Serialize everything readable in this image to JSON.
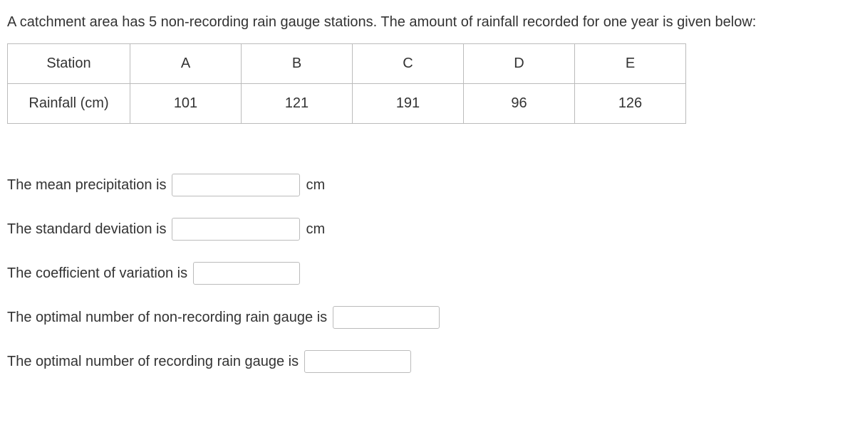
{
  "intro": "A catchment area has 5 non-recording rain gauge stations. The amount of rainfall recorded for one year is given below:",
  "table": {
    "row1": {
      "header": "Station",
      "cells": [
        "A",
        "B",
        "C",
        "D",
        "E"
      ]
    },
    "row2": {
      "header": "Rainfall (cm)",
      "cells": [
        "101",
        "121",
        "191",
        "96",
        "126"
      ]
    }
  },
  "questions": {
    "q1": {
      "label": "The mean precipitation is",
      "unit": "cm"
    },
    "q2": {
      "label": "The standard deviation is",
      "unit": "cm"
    },
    "q3": {
      "label": "The coefficient of variation is"
    },
    "q4": {
      "label": "The optimal number of non-recording  rain gauge is"
    },
    "q5": {
      "label": "The optimal number of recording  rain gauge is"
    }
  }
}
